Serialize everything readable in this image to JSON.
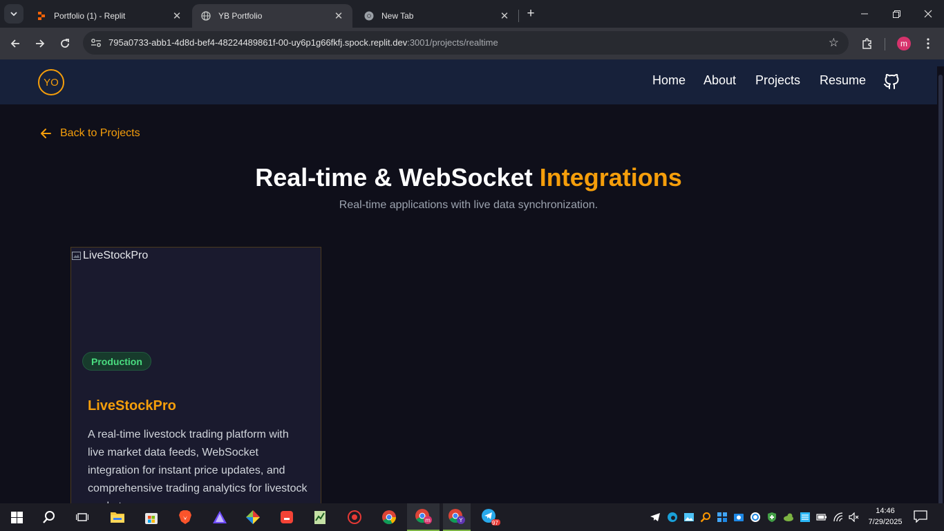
{
  "browser": {
    "tabs": [
      {
        "title": "Portfolio (1) - Replit",
        "icon": "replit-icon",
        "active": false
      },
      {
        "title": "YB Portfolio",
        "icon": "globe-icon",
        "active": true
      },
      {
        "title": "New Tab",
        "icon": "chrome-icon",
        "active": false
      }
    ],
    "url_host": "795a0733-abb1-4d8d-bef4-48224489861f-00-uy6p1g66fkfj.spock.replit.dev",
    "url_rest": ":3001/projects/realtime",
    "profile_initial": "m"
  },
  "site": {
    "logo": "YO",
    "nav": [
      "Home",
      "About",
      "Projects",
      "Resume"
    ],
    "back_label": "Back to Projects",
    "heading_main": "Real-time & WebSocket",
    "heading_accent": "Integrations",
    "subheading": "Real-time applications with live data synchronization.",
    "accent_color": "#f59e0b",
    "projects": [
      {
        "image_alt": "LiveStockPro",
        "badge": "Production",
        "title": "LiveStockPro",
        "description": "A real-time livestock trading platform with live market data feeds, WebSocket integration for instant price updates, and comprehensive trading analytics for livestock markets."
      }
    ]
  },
  "taskbar": {
    "telegram_badge": "97",
    "time": "14:46",
    "date": "7/29/2025"
  }
}
